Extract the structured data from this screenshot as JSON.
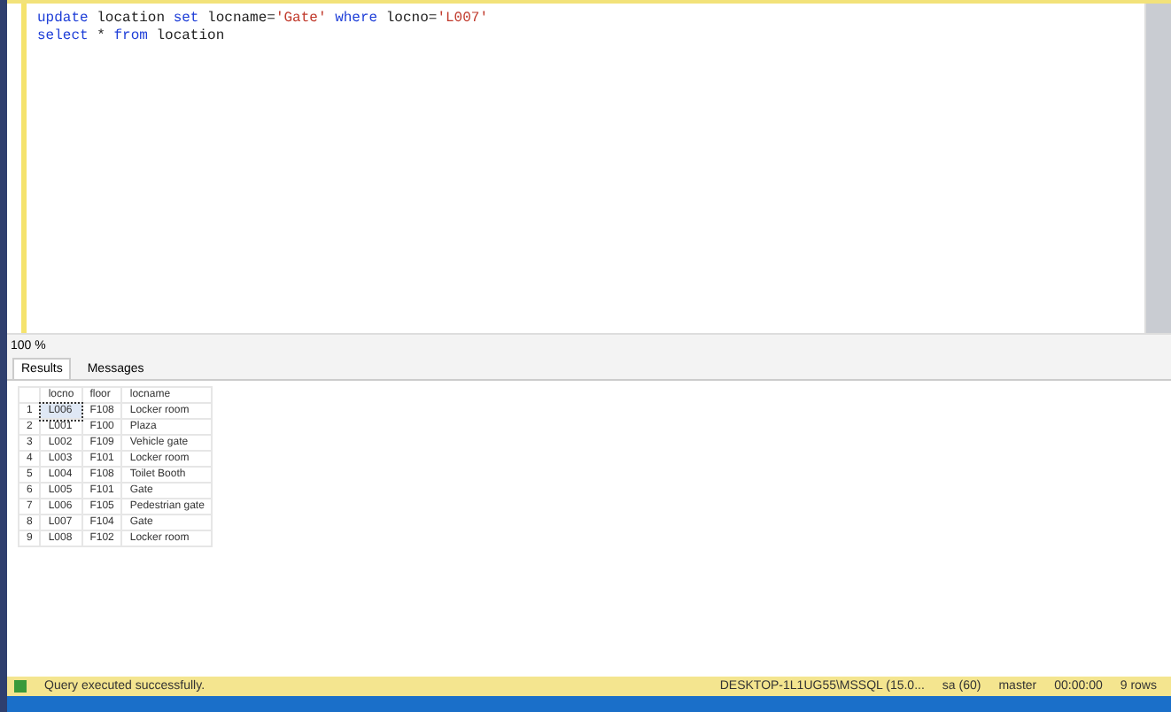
{
  "editor": {
    "lines": [
      {
        "parts": [
          {
            "kind": "keyword",
            "text": "update"
          },
          {
            "kind": "plain",
            "text": " location "
          },
          {
            "kind": "keyword",
            "text": "set"
          },
          {
            "kind": "plain",
            "text": " locname="
          },
          {
            "kind": "string",
            "text": "'Gate'"
          },
          {
            "kind": "keyword",
            "text": " where"
          },
          {
            "kind": "plain",
            "text": " locno="
          },
          {
            "kind": "string",
            "text": "'L007'"
          }
        ]
      },
      {
        "parts": [
          {
            "kind": "keyword",
            "text": "select"
          },
          {
            "kind": "plain",
            "text": " * "
          },
          {
            "kind": "keyword",
            "text": "from"
          },
          {
            "kind": "plain",
            "text": " location"
          }
        ]
      }
    ]
  },
  "zoom": "100 %",
  "tabs": [
    {
      "label": "Results",
      "selected": true
    },
    {
      "label": "Messages",
      "selected": false
    }
  ],
  "table": {
    "columns": [
      "locno",
      "floor",
      "locname"
    ],
    "rows": [
      {
        "num": "1",
        "cells": [
          "L006",
          "F108",
          "Locker room"
        ],
        "selected": true
      },
      {
        "num": "2",
        "cells": [
          "L001",
          "F100",
          "Plaza"
        ],
        "selected": false
      },
      {
        "num": "3",
        "cells": [
          "L002",
          "F109",
          "Vehicle gate"
        ],
        "selected": false
      },
      {
        "num": "4",
        "cells": [
          "L003",
          "F101",
          "Locker room"
        ],
        "selected": false
      },
      {
        "num": "5",
        "cells": [
          "L004",
          "F108",
          "Toilet Booth"
        ],
        "selected": false
      },
      {
        "num": "6",
        "cells": [
          "L005",
          "F101",
          "Gate"
        ],
        "selected": false
      },
      {
        "num": "7",
        "cells": [
          "L006",
          "F105",
          "Pedestrian gate"
        ],
        "selected": false
      },
      {
        "num": "8",
        "cells": [
          "L007",
          "F104",
          "Gate"
        ],
        "selected": false
      },
      {
        "num": "9",
        "cells": [
          "L008",
          "F102",
          "Locker room"
        ],
        "selected": false
      }
    ]
  },
  "status_bar": {
    "message": "Query executed successfully.",
    "items": [
      "DESKTOP-1L1UG55\\MSSQL (15.0...",
      "sa (60)",
      "master",
      "00:00:00",
      "9 rows"
    ]
  }
}
